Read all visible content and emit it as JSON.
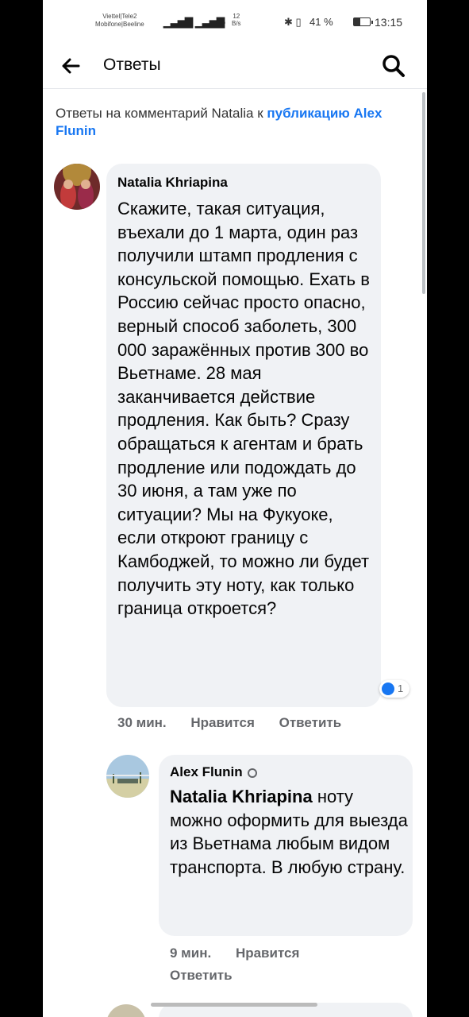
{
  "status_bar": {
    "carrier_line1": "Viettel|Tele2",
    "carrier_line2": "Mobifone|Beeline",
    "network_speed_value": "12",
    "network_speed_unit": "B/s",
    "battery_percent": "41 %",
    "time": "13:15",
    "battery_level": 0.41
  },
  "app_bar": {
    "title": "Ответы",
    "back_icon": "arrow-left-icon",
    "search_icon": "search-icon"
  },
  "context": {
    "prefix": "Ответы на комментарий Natalia к ",
    "link": "публикацию Alex Flunin"
  },
  "comment": {
    "author": "Natalia Khriapina",
    "text": "Скажите, такая ситуация, въехали до 1 марта, один раз получили штамп продления с консульской помощью. Ехать в Россию сейчас просто опасно, верный способ заболеть, 300 000 заражённых против 300 во Вьетнаме. 28 мая заканчивается действие продления. Как быть? Сразу обращаться к агентам и брать продление или подождать до 30 июня, а там уже по ситуации? Мы на Фукуоке, если откроют границу с Камбоджей, то можно ли будет получить эту ноту, как только граница откроется?",
    "time": "30 мин.",
    "like_label": "Нравится",
    "reply_label": "Ответить",
    "reaction_count": "1"
  },
  "reply": {
    "author": "Alex Flunin",
    "mention": "Natalia Khriapina",
    "text": " ноту можно оформить для выезда из Вьетнама любым видом транспорта. В любую страну.",
    "time": "9 мин.",
    "like_label": "Нравится",
    "reply_label": "Ответить"
  }
}
